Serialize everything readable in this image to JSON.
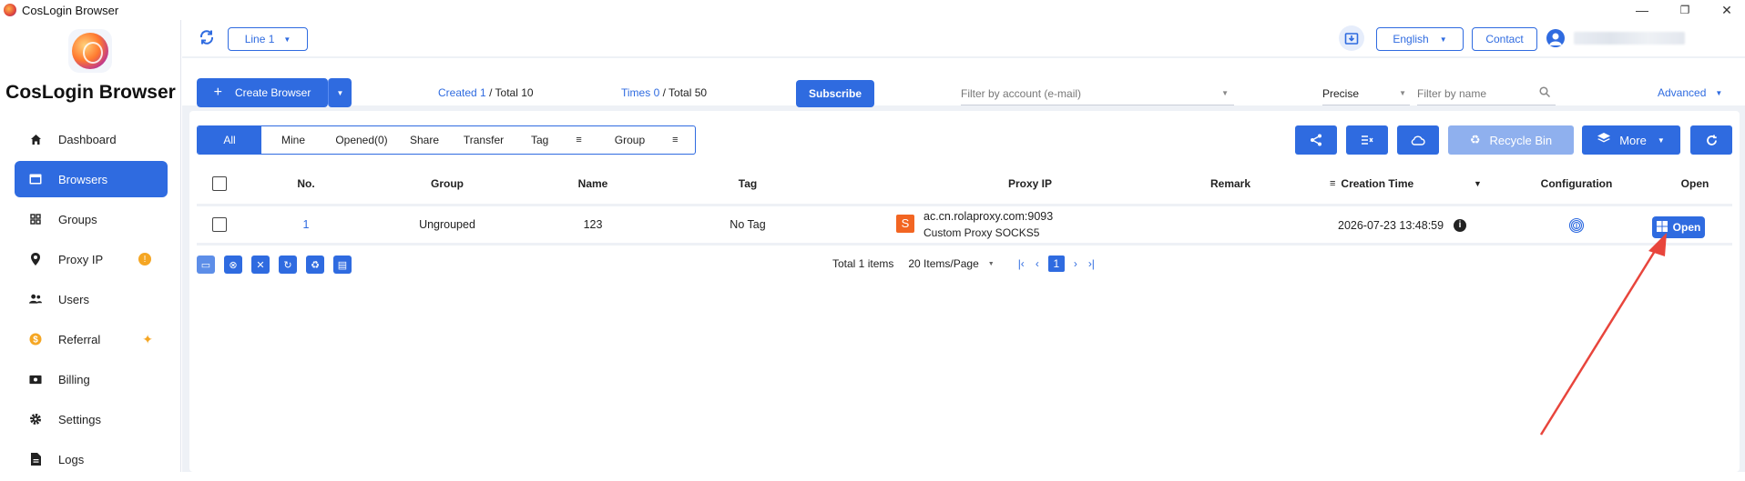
{
  "window": {
    "title": "CosLogin Browser",
    "minimize": "—",
    "restore": "❐",
    "close": "✕"
  },
  "brand": "CosLogin Browser",
  "sidebar": {
    "items": [
      {
        "label": "Dashboard",
        "icon": "home-icon"
      },
      {
        "label": "Browsers",
        "icon": "browser-window-icon"
      },
      {
        "label": "Groups",
        "icon": "grid-icon"
      },
      {
        "label": "Proxy IP",
        "icon": "location-pin-icon"
      },
      {
        "label": "Users",
        "icon": "users-icon"
      },
      {
        "label": "Referral",
        "icon": "dollar-coin-icon"
      },
      {
        "label": "Billing",
        "icon": "billing-icon"
      },
      {
        "label": "Settings",
        "icon": "gear-icon"
      },
      {
        "label": "Logs",
        "icon": "document-icon"
      }
    ]
  },
  "topbar": {
    "line": "Line 1",
    "language": "English",
    "contact": "Contact"
  },
  "toolbar": {
    "create": "Create Browser",
    "created_label": "Created",
    "created_value": "1",
    "created_total": " / Total 10",
    "times_label": "Times",
    "times_value": "0",
    "times_total": " / Total 50",
    "subscribe": "Subscribe",
    "account_placeholder": "Filter by account (e-mail)",
    "precise": "Precise",
    "name_placeholder": "Filter by name",
    "advanced": "Advanced"
  },
  "filters": {
    "all": "All",
    "mine": "Mine",
    "opened": "Opened(0)",
    "share": "Share",
    "transfer": "Transfer",
    "tag": "Tag",
    "group": "Group"
  },
  "actions": {
    "recycle": "Recycle Bin",
    "more": "More"
  },
  "table": {
    "headers": {
      "no": "No.",
      "group": "Group",
      "name": "Name",
      "tag": "Tag",
      "proxy": "Proxy IP",
      "remark": "Remark",
      "created": "Creation Time",
      "config": "Configuration",
      "open": "Open"
    },
    "rows": [
      {
        "no": "1",
        "group": "Ungrouped",
        "name": "123",
        "tag": "No Tag",
        "proxy_host": "ac.cn.rolaproxy.com:9093",
        "proxy_type": "Custom Proxy SOCKS5",
        "proxy_badge": "S",
        "created": "2026-07-23 13:48:59",
        "open": "Open"
      }
    ]
  },
  "pager": {
    "total": "Total 1 items",
    "per_page": "20 Items/Page",
    "page": "1"
  },
  "colors": {
    "accent": "#2f6be0",
    "proxy_badge": "#f26522",
    "annotation_arrow": "#e8453c"
  }
}
